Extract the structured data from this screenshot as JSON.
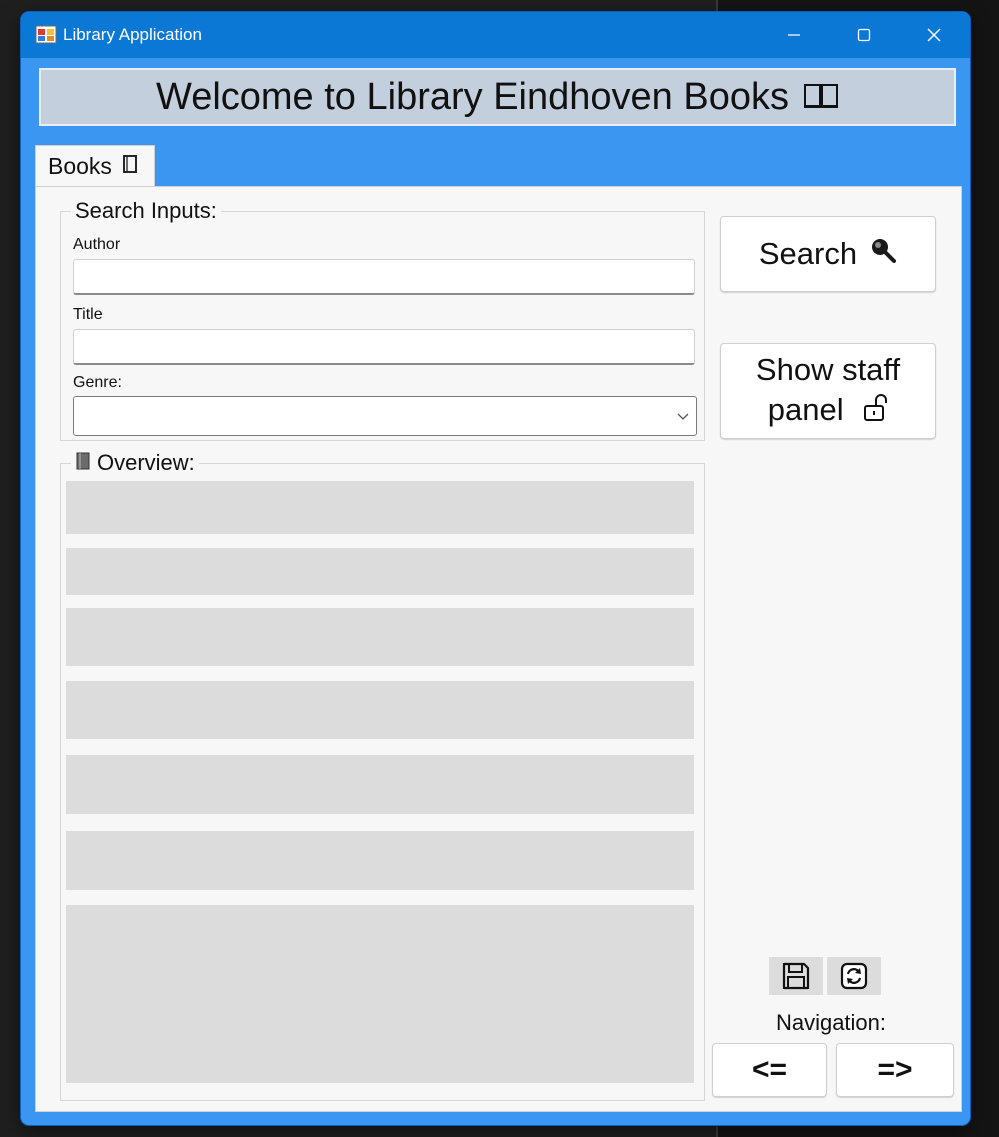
{
  "window": {
    "title": "Library Application"
  },
  "header": {
    "banner": "Welcome to Library Eindhoven Books"
  },
  "tabs": [
    {
      "label": "Books"
    }
  ],
  "search_group": {
    "legend": "Search Inputs:",
    "author_label": "Author",
    "author_value": "",
    "title_label": "Title",
    "title_value": "",
    "genre_label": "Genre:",
    "genre_value": ""
  },
  "overview": {
    "legend": "Overview:",
    "rows": [
      "",
      "",
      "",
      "",
      "",
      "",
      ""
    ]
  },
  "actions": {
    "search_label": "Search",
    "staff_label_line1": "Show staff",
    "staff_label_line2": "panel"
  },
  "navigation": {
    "label": "Navigation:",
    "prev_label": "<=",
    "next_label": "=>"
  },
  "icons": {
    "app": "app-icon",
    "banner": "open-book-icon",
    "tab": "book-icon",
    "search": "magnifier-icon",
    "staff": "unlock-icon",
    "overview": "notebook-icon",
    "save": "floppy-disk-icon",
    "refresh": "refresh-icon"
  },
  "colors": {
    "titlebar": "#0b78d6",
    "window_frame": "#3a96f0",
    "banner_bg": "#c3cfdc",
    "panel_bg": "#f7f7f7",
    "row_bg": "#dcdcdc"
  }
}
